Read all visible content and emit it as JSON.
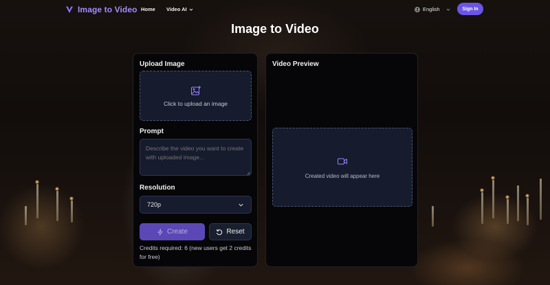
{
  "header": {
    "brand_name": "Image to Video",
    "nav": {
      "home": "Home",
      "video_ai": "Video AI"
    },
    "language": "English",
    "sign_in": "Sign In"
  },
  "page_title": "Image to Video",
  "upload_panel": {
    "upload_label": "Upload Image",
    "upload_text": "Click to upload an image",
    "prompt_label": "Prompt",
    "prompt_placeholder": "Describe the video you want to create with uploaded image...",
    "resolution_label": "Resolution",
    "resolution_value": "720p",
    "create_label": "Create",
    "reset_label": "Reset",
    "credits_text": "Credits required: 6 (new users get 2 credits for free)"
  },
  "preview_panel": {
    "label": "Video Preview",
    "placeholder_text": "Created video will appear here"
  },
  "colors": {
    "accent": "#6b55e6",
    "brand_text": "#a48cff",
    "panel_bg": "#060608",
    "field_bg": "#161b2d"
  },
  "icons": {
    "brand": "v-logo-icon",
    "language": "globe-icon",
    "upload": "image-plus-icon",
    "resolution": "chevron-down-icon",
    "create": "zap-icon",
    "reset": "rotate-ccw-icon",
    "preview": "video-camera-icon"
  }
}
